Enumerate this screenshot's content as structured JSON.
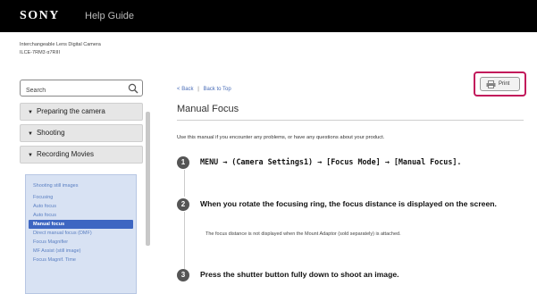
{
  "header": {
    "brand": "SONY",
    "guide_title": "Help Guide"
  },
  "product": {
    "line1": "Interchangeable Lens Digital Camera",
    "line2": "ILCE-7RM3 α7RIII"
  },
  "search": {
    "value": "Search"
  },
  "sidebar": {
    "sections": [
      {
        "label": "Preparing the camera"
      },
      {
        "label": "Shooting"
      },
      {
        "label": "Recording Movies"
      }
    ],
    "subitems": [
      {
        "label": "Shooting still images"
      },
      {
        "label": "Focusing"
      },
      {
        "label": "Auto focus"
      },
      {
        "label": "Auto focus"
      },
      {
        "label": "Manual focus"
      },
      {
        "label": "Direct manual focus (DMF)"
      },
      {
        "label": "Focus Magnifier"
      },
      {
        "label": "MF Assist (still image)"
      },
      {
        "label": "Focus Magnif. Time"
      }
    ]
  },
  "breadcrumb": {
    "back": "Back",
    "back_to_top": "Back to Top"
  },
  "page": {
    "title": "Manual Focus",
    "intro": "Use this manual if you encounter any problems, or have any questions about your product."
  },
  "print": {
    "label": "Print"
  },
  "steps": [
    {
      "num": "1",
      "text": "MENU → (Camera Settings1) → [Focus Mode] → [Manual Focus]."
    },
    {
      "num": "2",
      "text": "When you rotate the focusing ring, the focus distance is displayed on the screen.",
      "note": "The focus distance is not displayed when the Mount Adaptor (sold separately) is attached."
    },
    {
      "num": "3",
      "text": "Press the shutter button fully down to shoot an image."
    }
  ],
  "colors": {
    "topbar": "#000000",
    "active_item": "#3d66c2",
    "link": "#4a6db8",
    "print_highlight": "#c2185b"
  }
}
